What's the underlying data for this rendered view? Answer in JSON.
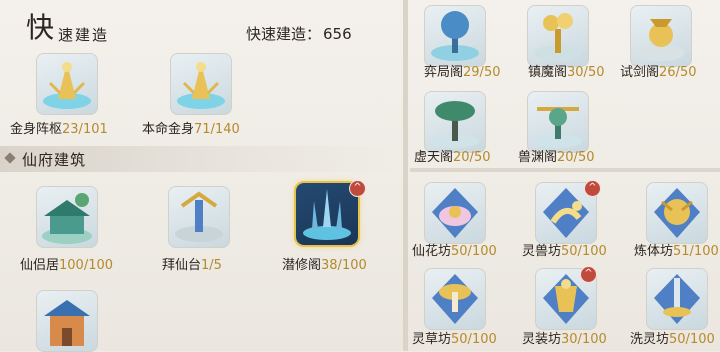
{
  "header": {
    "big_char": "快",
    "title_rest": "速建造",
    "quick_label": "快速建造：",
    "quick_value": "656"
  },
  "left_top": [
    {
      "name": "金身阵枢",
      "level": "23/101"
    },
    {
      "name": "本命金身",
      "level": "71/140"
    }
  ],
  "section": {
    "title": "仙府建筑"
  },
  "left_buildings": [
    {
      "name": "仙侣居",
      "level": "100/100",
      "upgrade": false
    },
    {
      "name": "拜仙台",
      "level": "1/5",
      "upgrade": false
    },
    {
      "name": "潜修阁",
      "level": "38/100",
      "upgrade": true,
      "selected": true
    }
  ],
  "right_top": [
    {
      "name": "弈局阁",
      "level": "29/50"
    },
    {
      "name": "镇魔阁",
      "level": "30/50"
    },
    {
      "name": "试剑阁",
      "level": "26/50"
    },
    {
      "name": "虚天阁",
      "level": "20/50"
    },
    {
      "name": "兽渊阁",
      "level": "20/50"
    }
  ],
  "right_bottom": [
    {
      "name": "仙花坊",
      "level": "50/100",
      "upgrade": false
    },
    {
      "name": "灵兽坊",
      "level": "50/100",
      "upgrade": true
    },
    {
      "name": "炼体坊",
      "level": "51/100",
      "upgrade": false
    },
    {
      "name": "灵草坊",
      "level": "50/100",
      "upgrade": false
    },
    {
      "name": "灵装坊",
      "level": "30/100",
      "upgrade": true
    },
    {
      "name": "洗灵坊",
      "level": "50/100",
      "upgrade": false
    }
  ],
  "badge_glyph": "^",
  "colors": {
    "level": "#b58a2c",
    "badge": "#c04a3b",
    "selected_border": "#e6c24a"
  }
}
